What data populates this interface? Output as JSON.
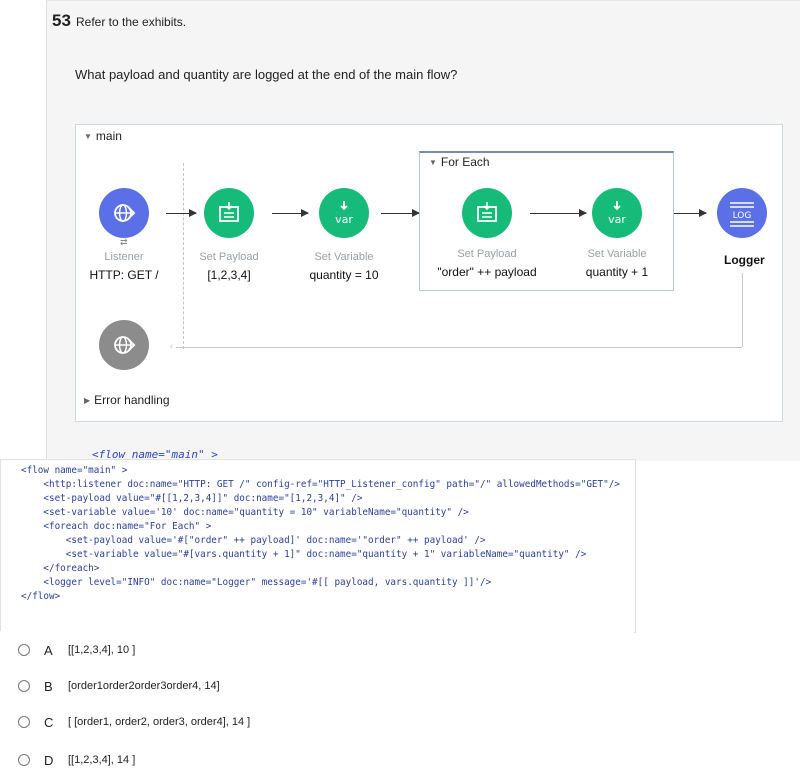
{
  "question": {
    "number": "53",
    "refer": "Refer to the exhibits.",
    "text": "What payload and quantity are logged at the end of the main flow?"
  },
  "diagram": {
    "flow_name": "main",
    "foreach_title": "For Each",
    "error_handling": "Error handling",
    "components": [
      {
        "label": "Listener",
        "value": "HTTP: GET /",
        "icon": "globe-icon",
        "color": "#5b6fe6"
      },
      {
        "label": "Set Payload",
        "value": "[1,2,3,4]",
        "icon": "set-payload-icon",
        "color": "#16bb7a"
      },
      {
        "label": "Set Variable",
        "value": "quantity = 10",
        "icon": "var-icon",
        "icon_text": "var",
        "color": "#16bb7a"
      },
      {
        "label": "Set Payload",
        "value": "\"order\" ++ payload",
        "icon": "set-payload-icon",
        "color": "#16bb7a"
      },
      {
        "label": "Set Variable",
        "value": "quantity + 1",
        "icon": "var-icon",
        "icon_text": "var",
        "color": "#16bb7a"
      },
      {
        "label": "Logger",
        "icon": "logger-icon",
        "icon_text": "LOG",
        "color": "#5b6fe6"
      }
    ]
  },
  "code": {
    "partial_line": "<flow name=\"main\" >",
    "lines": [
      "<flow name=\"main\" >",
      "    <http:listener doc:name=\"HTTP: GET /\" config-ref=\"HTTP_Listener_config\" path=\"/\" allowedMethods=\"GET\"/>",
      "    <set-payload value=\"#[[1,2,3,4]]\" doc:name=\"[1,2,3,4]\" />",
      "    <set-variable value='10' doc:name=\"quantity = 10\" variableName=\"quantity\" />",
      "    <foreach doc:name=\"For Each\" >",
      "        <set-payload value='#[\"order\" ++ payload]' doc:name='\"order\" ++ payload' />",
      "        <set-variable value=\"#[vars.quantity + 1]\" doc:name=\"quantity + 1\" variableName=\"quantity\" />",
      "    </foreach>",
      "    <logger level=\"INFO\" doc:name=\"Logger\" message='#[[ payload, vars.quantity ]]'/>",
      "</flow>"
    ]
  },
  "options": [
    {
      "letter": "A",
      "text": "[[1,2,3,4], 10 ]"
    },
    {
      "letter": "B",
      "text": "[order1order2order3order4, 14]"
    },
    {
      "letter": "C",
      "text": "[ [order1, order2, order3, order4], 14 ]"
    },
    {
      "letter": "D",
      "text": "[[1,2,3,4], 14 ]"
    }
  ]
}
